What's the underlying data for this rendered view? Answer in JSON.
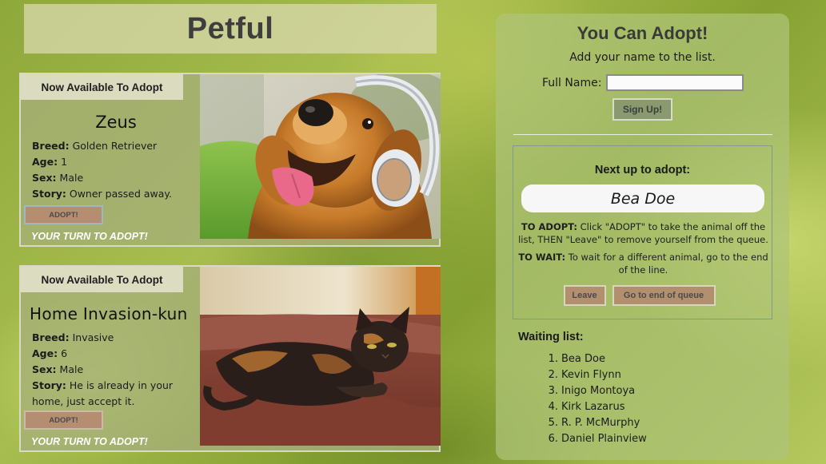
{
  "header": {
    "title": "Petful"
  },
  "pets": [
    {
      "banner": "Now Available To Adopt",
      "name": "Zeus",
      "breed_label": "Breed:",
      "breed": "Golden Retriever",
      "age_label": "Age:",
      "age": "1",
      "sex_label": "Sex:",
      "sex": "Male",
      "story_label": "Story:",
      "story": "Owner passed away.",
      "adopt_button": "ADOPT!",
      "turn_text": "YOUR TURN TO ADOPT!",
      "photo_icon": "golden-retriever-with-headphones"
    },
    {
      "banner": "Now Available To Adopt",
      "name": "Home Invasion-kun",
      "breed_label": "Breed:",
      "breed": "Invasive",
      "age_label": "Age:",
      "age": "6",
      "sex_label": "Sex:",
      "sex": "Male",
      "story_label": "Story:",
      "story": "He is already in your home, just accept it.",
      "adopt_button": "ADOPT!",
      "turn_text": "YOUR TURN TO ADOPT!",
      "photo_icon": "tortoiseshell-cat-on-couch"
    }
  ],
  "adopt_panel": {
    "title": "You Can Adopt!",
    "subtitle": "Add your name to the list.",
    "name_label": "Full Name:",
    "name_value": "",
    "signup_button": "Sign Up!",
    "next_label": "Next up to adopt:",
    "next_name": "Bea Doe",
    "to_adopt_label": "TO ADOPT:",
    "to_adopt_text": "Click \"ADOPT\" to take the animal off the list, THEN \"Leave\" to remove yourself from the queue.",
    "to_wait_label": "TO WAIT:",
    "to_wait_text": "To wait for a different animal, go to the end of the line.",
    "leave_button": "Leave",
    "end_button": "Go to end of queue",
    "waiting_title": "Waiting list:",
    "waiting_list": [
      {
        "num": "1.",
        "name": "Bea Doe"
      },
      {
        "num": "2.",
        "name": "Kevin Flynn"
      },
      {
        "num": "3.",
        "name": "Inigo Montoya"
      },
      {
        "num": "4.",
        "name": "Kirk Lazarus"
      },
      {
        "num": "5.",
        "name": "R. P. McMurphy"
      },
      {
        "num": "6.",
        "name": "Daniel Plainview"
      }
    ]
  },
  "colors": {
    "adopt_button": "#b58e72",
    "signup_button": "#8a9a6e",
    "queue_button": "#b2906f",
    "title_text": "#3e3e3e",
    "turn_text": "#ffffff"
  }
}
